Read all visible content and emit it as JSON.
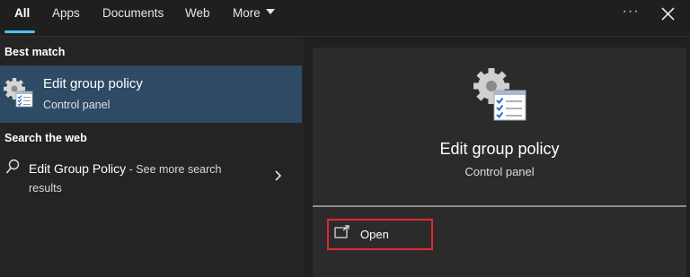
{
  "tabs": [
    {
      "label": "All",
      "active": true
    },
    {
      "label": "Apps"
    },
    {
      "label": "Documents"
    },
    {
      "label": "Web"
    },
    {
      "label": "More"
    }
  ],
  "toolbar": {
    "ellipsis_label": "···",
    "close_icon": "close-icon"
  },
  "left_panel": {
    "best_match_heading": "Best match",
    "best_match": {
      "title": "Edit group policy",
      "subtitle": "Control panel",
      "icon": "group-policy-icon"
    },
    "web_heading": "Search the web",
    "web_result": {
      "query": "Edit Group Policy",
      "suffix": " - See more search results",
      "icon": "search-icon"
    }
  },
  "detail_panel": {
    "title": "Edit group policy",
    "subtitle": "Control panel",
    "icon": "group-policy-icon",
    "actions": [
      {
        "label": "Open",
        "icon": "open-external-icon"
      }
    ]
  },
  "colors": {
    "accent": "#4cc2ff",
    "selection": "#2e4a64",
    "highlight_border": "#e0282e"
  }
}
